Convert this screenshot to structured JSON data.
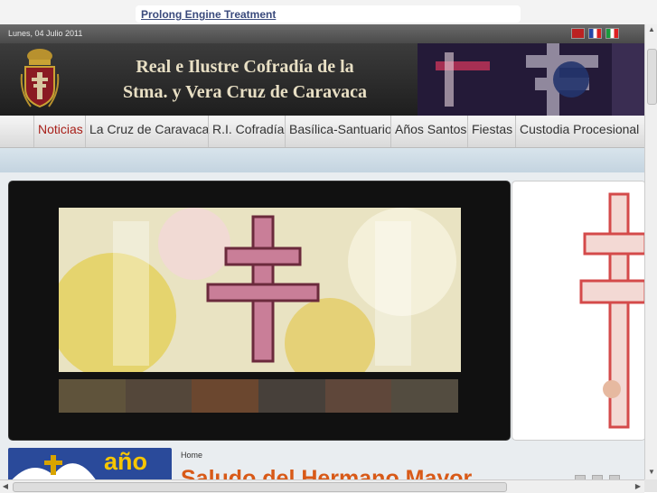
{
  "ad": {
    "link_text": "Prolong Engine Treatment"
  },
  "topbar": {
    "date": "Lunes, 04 Julio 2011",
    "languages": [
      "en",
      "fr",
      "it"
    ]
  },
  "header": {
    "title_line1": "Real e Ilustre Cofradía de la",
    "title_line2": "Stma. y Vera Cruz de Caravaca"
  },
  "nav": {
    "items": [
      {
        "label": "Noticias",
        "active": true
      },
      {
        "label": "La Cruz de Caravaca"
      },
      {
        "label": "R.I. Cofradía"
      },
      {
        "label": "Basílica-Santuario"
      },
      {
        "label": "Años Santos"
      },
      {
        "label": "Fiestas"
      },
      {
        "label": "Custodia Procesional"
      }
    ]
  },
  "banner": {
    "text": "año"
  },
  "breadcrumb": "Home",
  "article": {
    "title": "Saludo del Hermano Mayor"
  },
  "colors": {
    "accent_active": "#a8201a",
    "title_orange": "#d85a18",
    "banner_blue": "#2a4a9a",
    "banner_yellow": "#f7c600"
  }
}
